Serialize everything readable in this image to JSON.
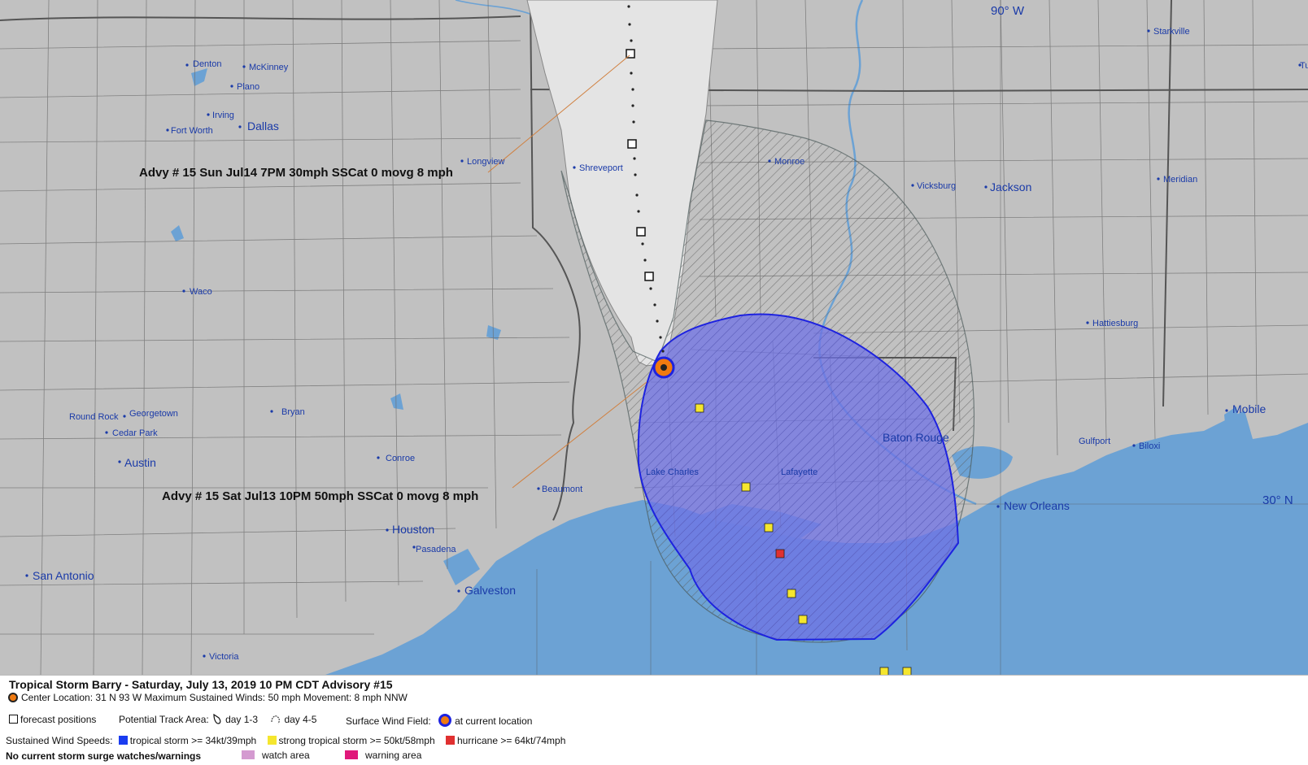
{
  "map": {
    "grid_labels": {
      "lon": "90° W",
      "lat": "30° N"
    },
    "advisory_labels": {
      "forecast": "Advy # 15 Sun Jul14 7PM  30mph SSCat 0 movg 8 mph",
      "current": "Advy # 15 Sat Jul13 10PM  50mph SSCat 0 movg 8 mph"
    },
    "cities": {
      "denton": "Denton",
      "mckinney": "McKinney",
      "plano": "Plano",
      "irving": "Irving",
      "fortworth": "Fort Worth",
      "dallas": "Dallas",
      "longview": "Longview",
      "shreveport": "Shreveport",
      "monroe": "Monroe",
      "vicksburg": "Vicksburg",
      "jackson": "Jackson",
      "meridian": "Meridian",
      "starkville": "Starkville",
      "tu": "Tu",
      "waco": "Waco",
      "hattiesburg": "Hattiesburg",
      "roundrock": "Round Rock",
      "georgetown": "Georgetown",
      "bryan": "Bryan",
      "cedarpark": "Cedar Park",
      "austin": "Austin",
      "conroe": "Conroe",
      "batonrouge": "Baton Rouge",
      "mobile": "Mobile",
      "gulfport": "Gulfport",
      "biloxi": "Biloxi",
      "lakecharles": "Lake Charles",
      "lafayette": "Lafayette",
      "beaumont": "Beaumont",
      "neworleans": "New Orleans",
      "houston": "Houston",
      "pasadena": "Pasadena",
      "sanantonio": "San Antonio",
      "galveston": "Galveston",
      "victoria": "Victoria"
    },
    "colors": {
      "land": "#c1c1c1",
      "water": "#6ca2d4",
      "cone_day13": "#e4e4e4",
      "wind_fill": "#6f72e6",
      "wind_stroke": "#1d22e0",
      "tropical_storm": "#1a3cf0",
      "strong_tropical_storm": "#f5e62e",
      "hurricane": "#e03030",
      "center": "#f07a10"
    }
  },
  "legend": {
    "title": "Tropical Storm Barry  -  Saturday, July 13, 2019  10 PM CDT   Advisory #15",
    "center_line": "Center Location: 31 N  93 W   Maximum Sustained Winds: 50 mph  Movement: 8 mph NNW",
    "forecast_positions": "forecast positions",
    "potential_track_area": "Potential Track Area:",
    "day13": "day 1-3",
    "day45": "day 4-5",
    "surface_wind_field": "Surface Wind Field:",
    "at_current_location": "at current location",
    "sustained_wind_speeds": "Sustained Wind Speeds:",
    "tropical_storm": "tropical storm >= 34kt/39mph",
    "strong_tropical_storm": "strong tropical storm >= 50kt/58mph",
    "hurricane": "hurricane >= 64kt/74mph",
    "no_surge": "No current storm surge watches/warnings",
    "watch_area": "watch area",
    "warning_area": "warning area",
    "watch_color": "#d49ad0",
    "warning_color": "#e0187a"
  }
}
